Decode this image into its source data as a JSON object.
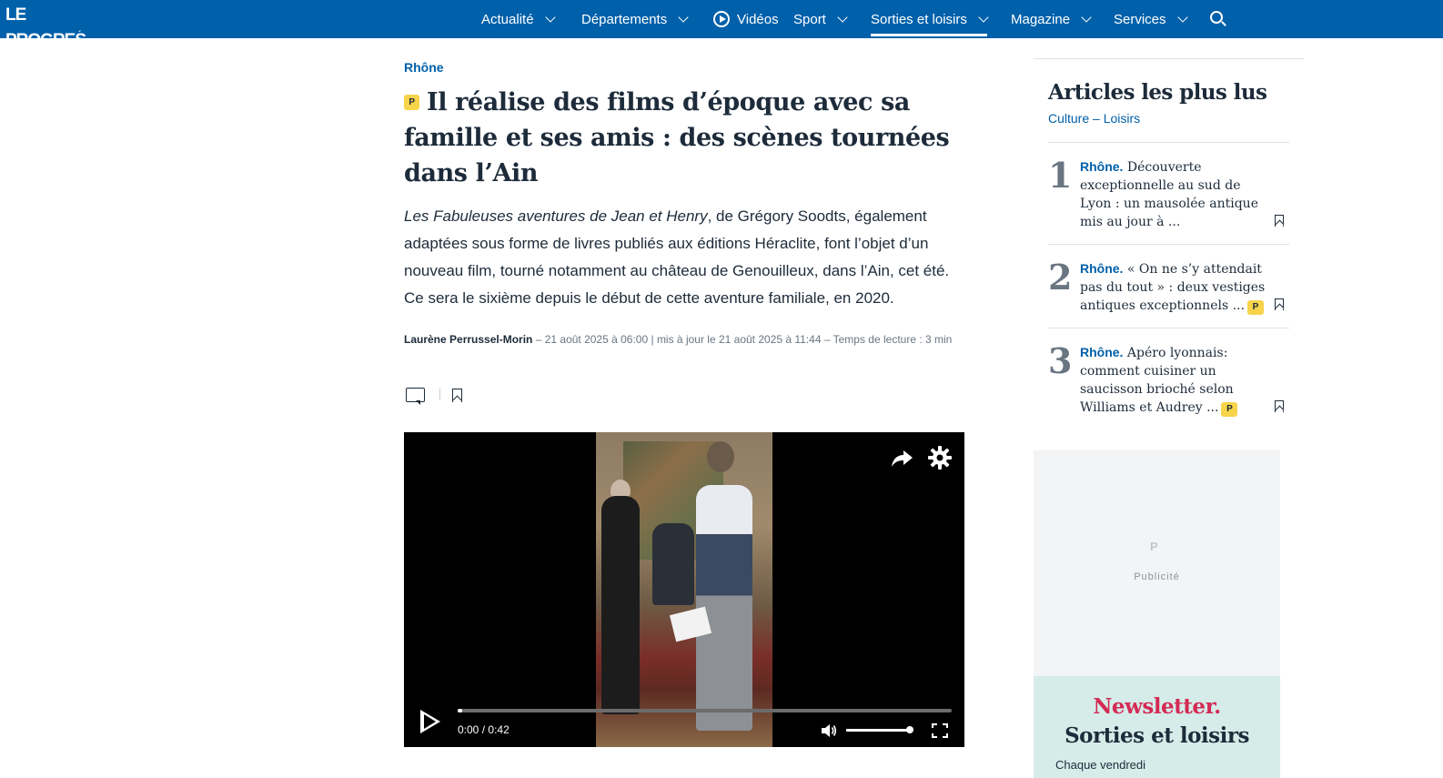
{
  "header": {
    "logo": "LE PROGRES",
    "logo_accent": "´",
    "nav": [
      {
        "label": "Actualité"
      },
      {
        "label": "Départements"
      },
      {
        "label": "Vidéos"
      },
      {
        "label": "Sport"
      },
      {
        "label": "Sorties et loisirs"
      },
      {
        "label": "Magazine"
      },
      {
        "label": "Services"
      }
    ],
    "active_nav": "Sorties et loisirs",
    "brand_color": "#0060aa"
  },
  "article": {
    "kicker": "Rhône",
    "premium_badge": "P",
    "title": "Il réalise des films d’époque avec sa famille et ses amis : des scènes tournées dans l’Ain",
    "chapo_italic": "Les Fabuleuses aventures de Jean et Henry",
    "chapo_rest": ", de Grégory Soodts, également adaptées sous forme de livres publiés aux éditions Héraclite, font l’objet d’un nouveau film, tourné notamment au château de Genouilleux, dans l’Ain, cet été. Ce sera le sixième depuis le début de cette aventure familiale, en 2020.",
    "author": "Laurène Perrussel-Morin",
    "meta": " – 21 août 2025 à 06:00 | mis à jour le 21 août 2025 à 11:44 – Temps de lecture : 3 min"
  },
  "video": {
    "current_time": "0:00",
    "separator": "/",
    "duration": "0:42",
    "progress_fraction": 0.01,
    "volume_fraction": 1.0
  },
  "sidebar": {
    "title": "Articles les plus lus",
    "subtitle": "Culture – Loisirs",
    "items": [
      {
        "rank": "1",
        "rubric": "Rhône.",
        "text": " Découverte exceptionnelle au sud de Lyon : un mausolée antique mis au jour à ...",
        "premium": false
      },
      {
        "rank": "2",
        "rubric": "Rhône.",
        "text": " « On ne s’y attendait pas du tout » : deux vestiges antiques exceptionnels ...",
        "premium": true
      },
      {
        "rank": "3",
        "rubric": "Rhône.",
        "text": " Apéro lyonnais: comment cuisiner un saucisson brioché selon Williams et Audrey ...",
        "premium": true
      }
    ],
    "ad_logo": "P",
    "ad_label": "Publicité",
    "newsletter_title": "Newsletter.",
    "newsletter_topic": "Sorties et loisirs",
    "newsletter_freq": "Chaque vendredi"
  }
}
